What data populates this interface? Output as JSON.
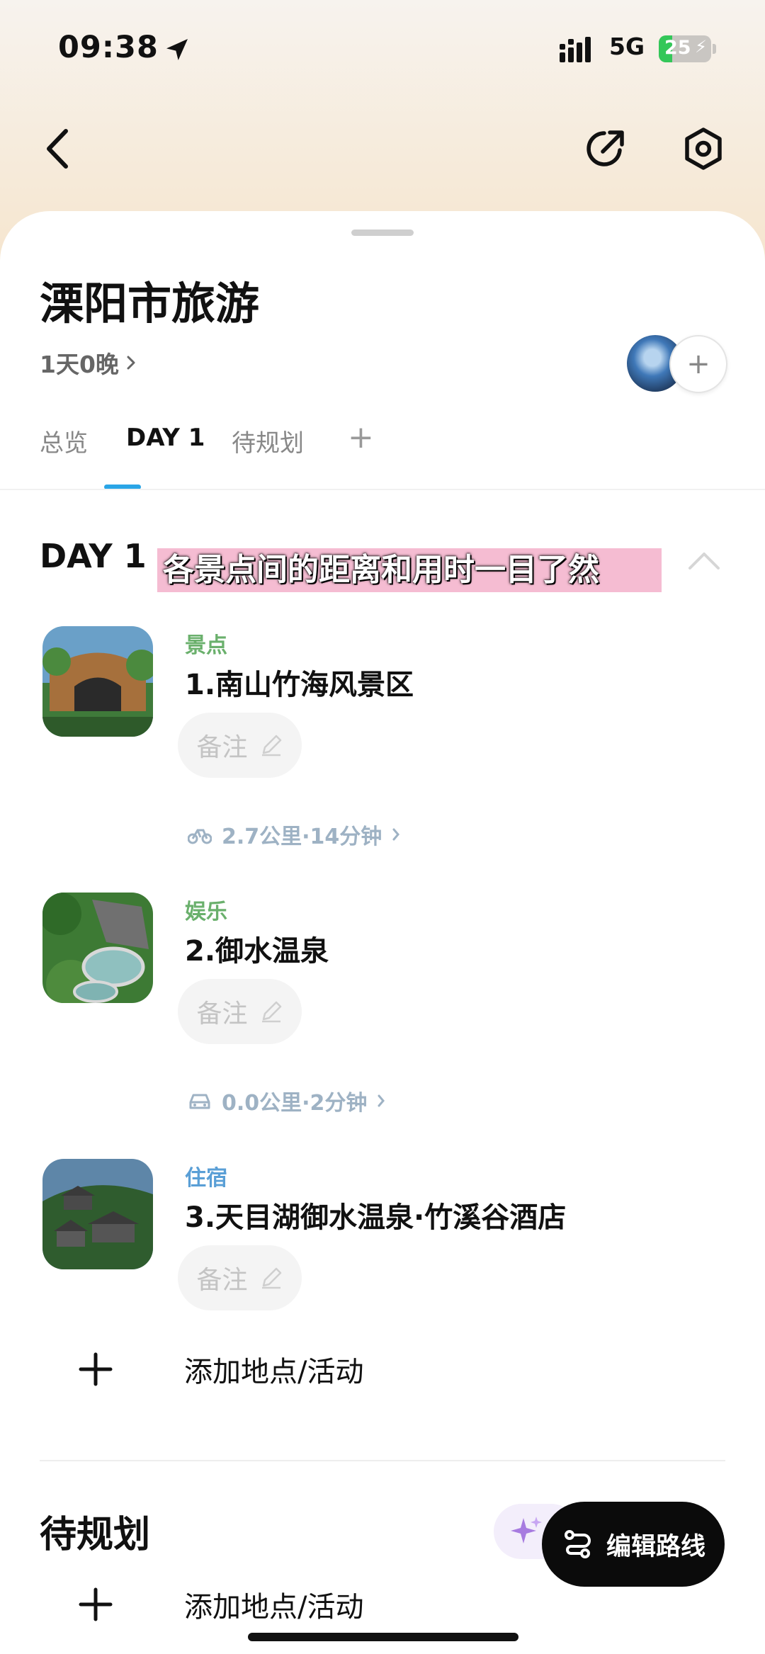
{
  "status_bar": {
    "time": "09:38",
    "network": "5G",
    "battery": "25",
    "battery_level": 0.25
  },
  "trip": {
    "title": "溧阳市旅游",
    "duration": "1天0晚"
  },
  "tabs": [
    {
      "label": "总览"
    },
    {
      "label": "DAY 1"
    },
    {
      "label": "待规划"
    },
    {
      "label": "+"
    }
  ],
  "day": {
    "heading": "DAY 1",
    "caption": "各景点间的距离和用时一目了然"
  },
  "items": [
    {
      "category": "景点",
      "category_color": "#6ab06c",
      "name": "1.南山竹海风景区",
      "note": "备注"
    },
    {
      "category": "娱乐",
      "category_color": "#6ab06c",
      "name": "2.御水温泉",
      "note": "备注"
    },
    {
      "category": "住宿",
      "category_color": "#5a9fd6",
      "name": "3.天目湖御水温泉·竹溪谷酒店",
      "note": "备注"
    }
  ],
  "segments": [
    {
      "icon": "bicycle-icon",
      "text": "2.7公里·14分钟"
    },
    {
      "icon": "car-icon",
      "text": "0.0公里·2分钟"
    }
  ],
  "add_activity": "添加地点/活动",
  "pending": {
    "title": "待规划",
    "add_activity": "添加地点/活动"
  },
  "edit_route": "编辑路线"
}
